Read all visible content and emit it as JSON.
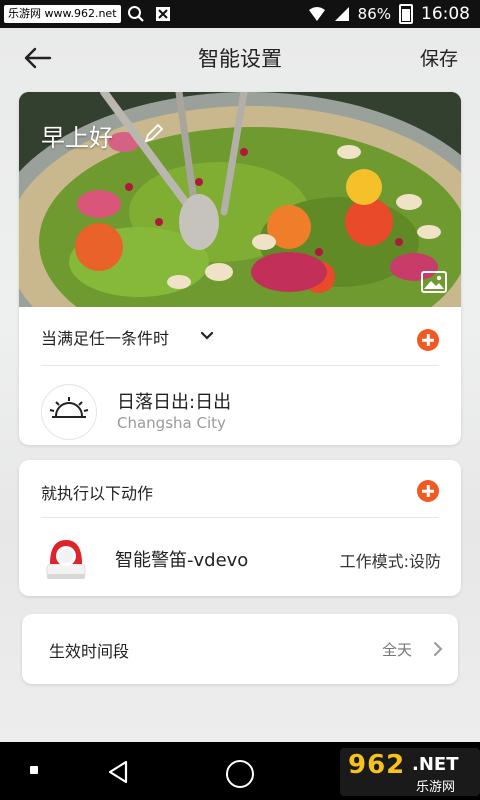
{
  "status_bar": {
    "watermark": "乐游网 www.962.net",
    "battery": "86%",
    "time": "16:08"
  },
  "header": {
    "title": "智能设置",
    "save_label": "保存"
  },
  "scene": {
    "name": "早上好"
  },
  "conditions": {
    "title": "当满足任一条件时",
    "items": [
      {
        "name": "日落日出:日出",
        "location": "Changsha City",
        "icon": "sunrise-icon"
      }
    ]
  },
  "actions": {
    "title": "就执行以下动作",
    "items": [
      {
        "name": "智能警笛-vdevo",
        "mode": "工作模式:设防",
        "icon": "siren-device"
      }
    ]
  },
  "effective_period": {
    "label": "生效时间段",
    "value": "全天"
  },
  "colors": {
    "accent": "#f05a22",
    "text": "#222222",
    "muted": "#9a9a9a"
  },
  "nav_watermark": {
    "number": "962",
    "net": ".NET",
    "cn": "乐游网"
  }
}
